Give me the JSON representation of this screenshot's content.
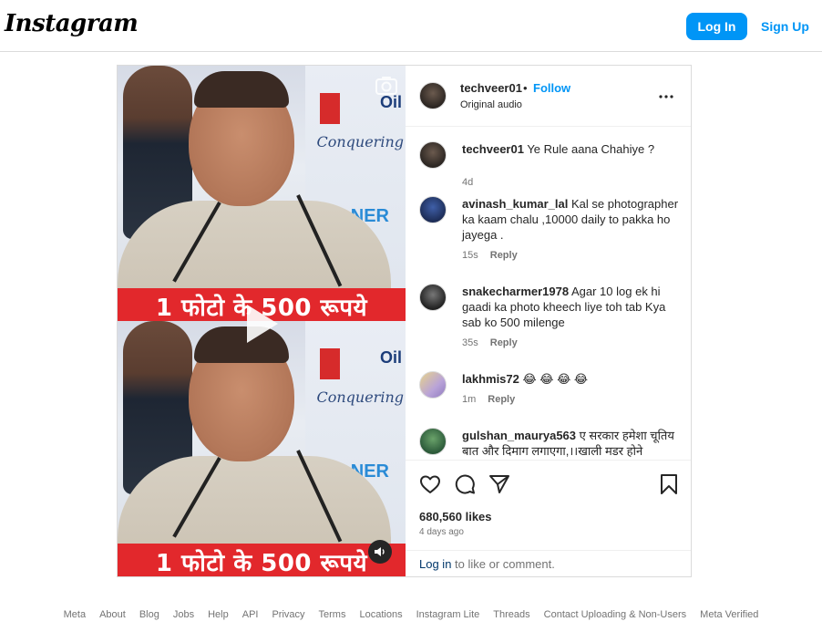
{
  "header": {
    "logo": "Instagram",
    "login_label": "Log In",
    "signup_label": "Sign Up"
  },
  "media": {
    "caption_banner_top": "1 फोटो के 500 रूपये",
    "caption_banner_bottom": "1 फोटो के 500 रूपये",
    "backdrop_oil": "Oil",
    "backdrop_conquering": "Conquering",
    "backdrop_ner": "NER"
  },
  "post_header": {
    "username": "techveer01",
    "separator": "•",
    "follow_label": "Follow",
    "audio": "Original audio"
  },
  "comments": [
    {
      "user": "techveer01",
      "text": " Ye Rule aana Chahiye ?",
      "time": "4d",
      "reply": ""
    },
    {
      "user": "avinash_kumar_lal",
      "text": " Kal se photographer ka kaam chalu ,10000 daily to pakka ho jayega .",
      "time": "15s",
      "reply": "Reply"
    },
    {
      "user": "snakecharmer1978",
      "text": " Agar 10 log ek hi gaadi ka photo kheech liye toh tab Kya sab ko 500 milenge",
      "time": "35s",
      "reply": "Reply"
    },
    {
      "user": "lakhmis72",
      "text": " 😂 😂 😂 😂",
      "time": "1m",
      "reply": "Reply"
    },
    {
      "user": "gulshan_maurya563",
      "text": " ए सरकार हमेशा चूतिय बात और दिमाग लगाएगा,।।खाली मडर होने",
      "time": "",
      "reply": ""
    }
  ],
  "post_footer": {
    "likes": "680,560 likes",
    "time_ago": "4 days ago",
    "login_link": "Log in",
    "login_suffix": " to like or comment."
  },
  "footer_links": [
    "Meta",
    "About",
    "Blog",
    "Jobs",
    "Help",
    "API",
    "Privacy",
    "Terms",
    "Locations",
    "Instagram Lite",
    "Threads",
    "Contact Uploading & Non-Users",
    "Meta Verified"
  ],
  "colors": {
    "accent": "#0095f6",
    "border": "#dbdbdb",
    "banner_red": "#e2282c",
    "muted_text": "#737373"
  }
}
